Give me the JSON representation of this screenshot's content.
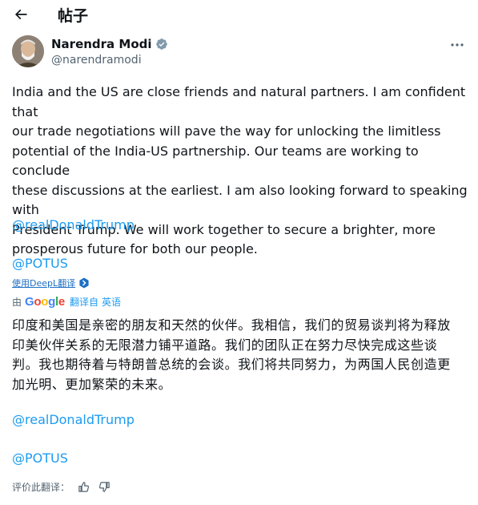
{
  "header": {
    "title": "帖子",
    "back_icon": "arrow-left-icon"
  },
  "author": {
    "name": "Narendra Modi",
    "handle": "@narendramodi",
    "verified": true
  },
  "tweet": {
    "lines": [
      "India and the US are close friends and natural partners. I am confident that",
      "our trade negotiations will pave the way for unlocking the limitless",
      "potential of the India-US partnership. Our teams are working to conclude",
      "these discussions at the earliest. I am also looking forward to speaking with",
      "President Trump. We will work together to secure a brighter, more",
      "prosperous future for both our people."
    ],
    "mention_1": "@realDonaldTrump",
    "mention_2": "@POTUS"
  },
  "deepl": {
    "label": "使用DeepL翻译"
  },
  "google_translate": {
    "prefix": "由",
    "brand": "Google",
    "translated_from": "翻译自",
    "source_language": "英语"
  },
  "translation": {
    "lines": [
      "印度和美国是亲密的朋友和天然的伙伴。我相信，我们的贸易谈判将为释放",
      "印美伙伴关系的无限潜力铺平道路。我们的团队正在努力尽快完成这些谈",
      "判。我也期待着与特朗普总统的会谈。我们将共同努力，为两国人民创造更",
      "加光明、更加繁荣的未来。"
    ],
    "mention_1": "@realDonaldTrump",
    "mention_2": "@POTUS"
  },
  "rate": {
    "label": "评价此翻译："
  },
  "colors": {
    "link": "#1d9bf0",
    "verified": "#829aab",
    "text": "#0f1419",
    "muted": "#536471"
  }
}
